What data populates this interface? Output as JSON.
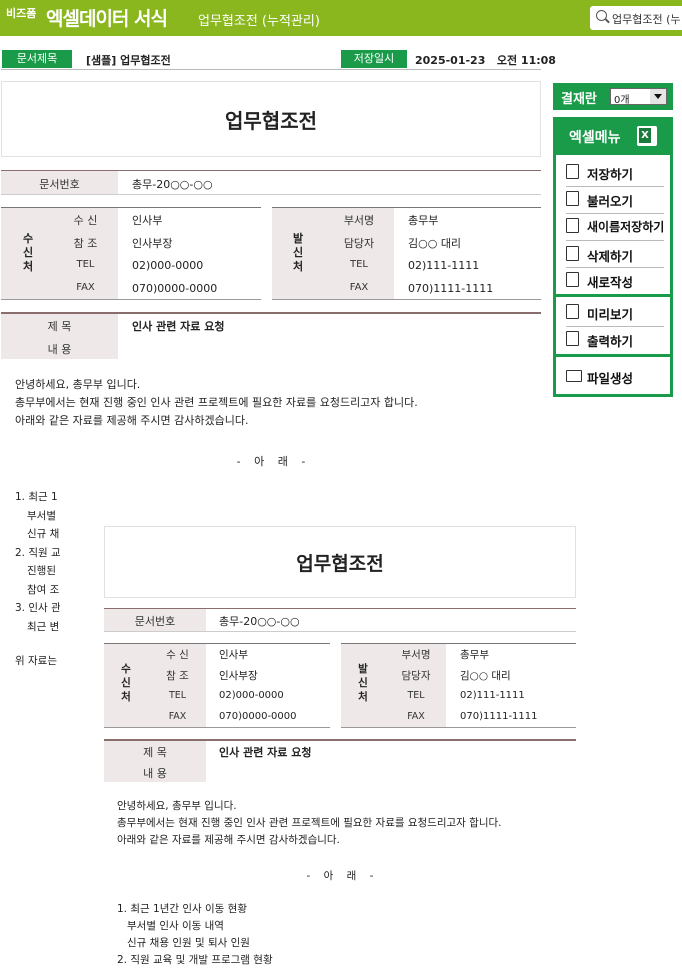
{
  "header": {
    "logo": "비즈폼",
    "app_name": "엑셀데이터 서식",
    "subtitle": "업무협조전 (누적관리)",
    "search_value": "업무협조전 (누"
  },
  "doc_meta": {
    "title_label": "문서제목",
    "title_value": "[샘플] 업무협조전",
    "saved_label": "저장일시",
    "saved_value": "2025-01-23   오전 11:08"
  },
  "doc": {
    "title": "업무협조전",
    "doc_no_label": "문서번호",
    "doc_no": "총무-20○○-○○",
    "recv": {
      "head": "수신처",
      "rows": [
        {
          "k": "수 신",
          "v": "인사부"
        },
        {
          "k": "참 조",
          "v": "인사부장"
        },
        {
          "k": "TEL",
          "v": "02)000-0000"
        },
        {
          "k": "FAX",
          "v": "070)0000-0000"
        }
      ]
    },
    "send": {
      "head": "발신처",
      "rows": [
        {
          "k": "부서명",
          "v": "총무부"
        },
        {
          "k": "담당자",
          "v": "김○○ 대리"
        },
        {
          "k": "TEL",
          "v": "02)111-1111"
        },
        {
          "k": "FAX",
          "v": "070)1111-1111"
        }
      ]
    },
    "subject_label": "제 목",
    "subject": "인사 관련 자료 요청",
    "content_label": "내 용",
    "body": [
      "안녕하세요, 총무부 입니다.",
      "총무부에서는 현재 진행 중인 인사 관련 프로젝트에 필요한 자료를 요청드리고자 합니다.",
      "아래와 같은 자료를 제공해 주시면 감사하겠습니다."
    ],
    "below": "- 아 래 -",
    "list": [
      "1. 최근 1년간 인사 이동 현황",
      "부서별 인사 이동 내역",
      "신규 채용 인원 및 퇴사 인원",
      "2. 직원 교육 및 개발 프로그램 현황"
    ],
    "list_partial": [
      "1. 최근 1",
      "부서별",
      "신규 채",
      "2. 직원 교",
      "진행된",
      "참여 조",
      "3. 인사 관",
      "최근 변"
    ],
    "closing_partial": "위 자료는"
  },
  "side": {
    "approval_label": "결재란",
    "approval_value": "0개",
    "menu_title": "엑셀메뉴",
    "items": [
      "저장하기",
      "불러오기",
      "새이름저장하기",
      "삭제하기",
      "새로작성",
      "미리보기",
      "출력하기",
      "파일생성"
    ]
  }
}
